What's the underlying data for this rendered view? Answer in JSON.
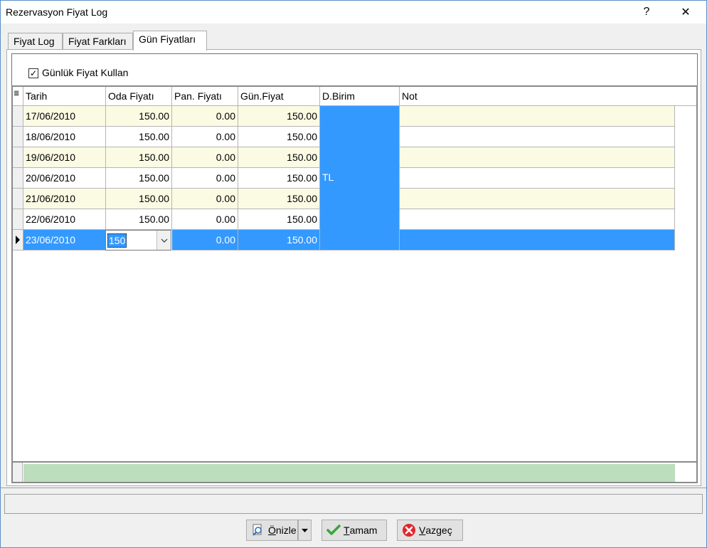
{
  "window": {
    "title": "Rezervasyon Fiyat Log",
    "help_glyph": "?",
    "close_glyph": "✕"
  },
  "tabs": [
    {
      "label": "Fiyat Log"
    },
    {
      "label": "Fiyat Farkları"
    },
    {
      "label": "Gün Fiyatları"
    }
  ],
  "option": {
    "label": "Günlük Fiyat Kullan",
    "checked": true,
    "check_glyph": "✓"
  },
  "grid": {
    "columns": [
      "Tarih",
      "Oda Fiyatı",
      "Pan. Fiyatı",
      "Gün.Fiyat",
      "D.Birim",
      "Not"
    ],
    "currency": "TL",
    "rows": [
      {
        "tarih": "17/06/2010",
        "oda": "150.00",
        "pan": "0.00",
        "gun": "150.00",
        "not": ""
      },
      {
        "tarih": "18/06/2010",
        "oda": "150.00",
        "pan": "0.00",
        "gun": "150.00",
        "not": ""
      },
      {
        "tarih": "19/06/2010",
        "oda": "150.00",
        "pan": "0.00",
        "gun": "150.00",
        "not": ""
      },
      {
        "tarih": "20/06/2010",
        "oda": "150.00",
        "pan": "0.00",
        "gun": "150.00",
        "not": ""
      },
      {
        "tarih": "21/06/2010",
        "oda": "150.00",
        "pan": "0.00",
        "gun": "150.00",
        "not": ""
      },
      {
        "tarih": "22/06/2010",
        "oda": "150.00",
        "pan": "0.00",
        "gun": "150.00",
        "not": ""
      }
    ],
    "selected_row": {
      "tarih": "23/06/2010",
      "oda_edit": "150",
      "pan": "0.00",
      "gun": "150.00",
      "not": ""
    }
  },
  "buttons": {
    "onizle": {
      "label_u": "Ö",
      "label_rest": "nizle"
    },
    "tamam": {
      "label_u": "T",
      "label_rest": "amam"
    },
    "vazgec": {
      "label_u": "V",
      "label_rest": "azgeç"
    }
  },
  "colors": {
    "selection": "#3399ff",
    "odd_row": "#fbfbe4",
    "footer": "#bcdebd"
  }
}
